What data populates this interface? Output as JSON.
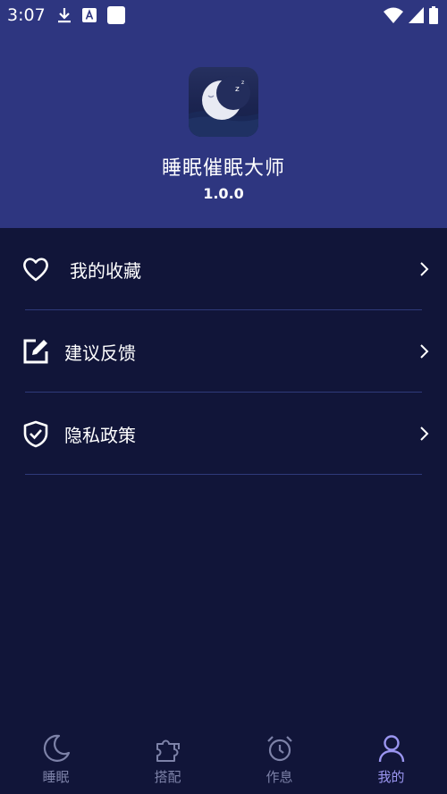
{
  "status_bar": {
    "time": "3:07",
    "left_icons": [
      "download-icon",
      "a-box-icon",
      "white-square-icon"
    ],
    "right_icons": [
      "wifi-icon",
      "signal-icon",
      "battery-icon"
    ]
  },
  "header": {
    "app_name": "睡眠催眠大师",
    "version": "1.0.0",
    "app_icon": "moon-sleep-icon"
  },
  "menu": {
    "items": [
      {
        "label": "我的收藏",
        "icon": "heart-icon"
      },
      {
        "label": "建议反馈",
        "icon": "edit-icon"
      },
      {
        "label": "隐私政策",
        "icon": "shield-check-icon"
      }
    ]
  },
  "bottom_nav": {
    "items": [
      {
        "label": "睡眠",
        "icon": "moon-icon",
        "active": false
      },
      {
        "label": "搭配",
        "icon": "puzzle-icon",
        "active": false
      },
      {
        "label": "作息",
        "icon": "alarm-clock-icon",
        "active": false
      },
      {
        "label": "我的",
        "icon": "user-icon",
        "active": true
      }
    ]
  },
  "colors": {
    "header_bg": "#2e3680",
    "page_bg": "#111539",
    "divider": "#2f3a7a",
    "nav_inactive": "#7d82a8",
    "nav_active": "#9a95f0"
  }
}
